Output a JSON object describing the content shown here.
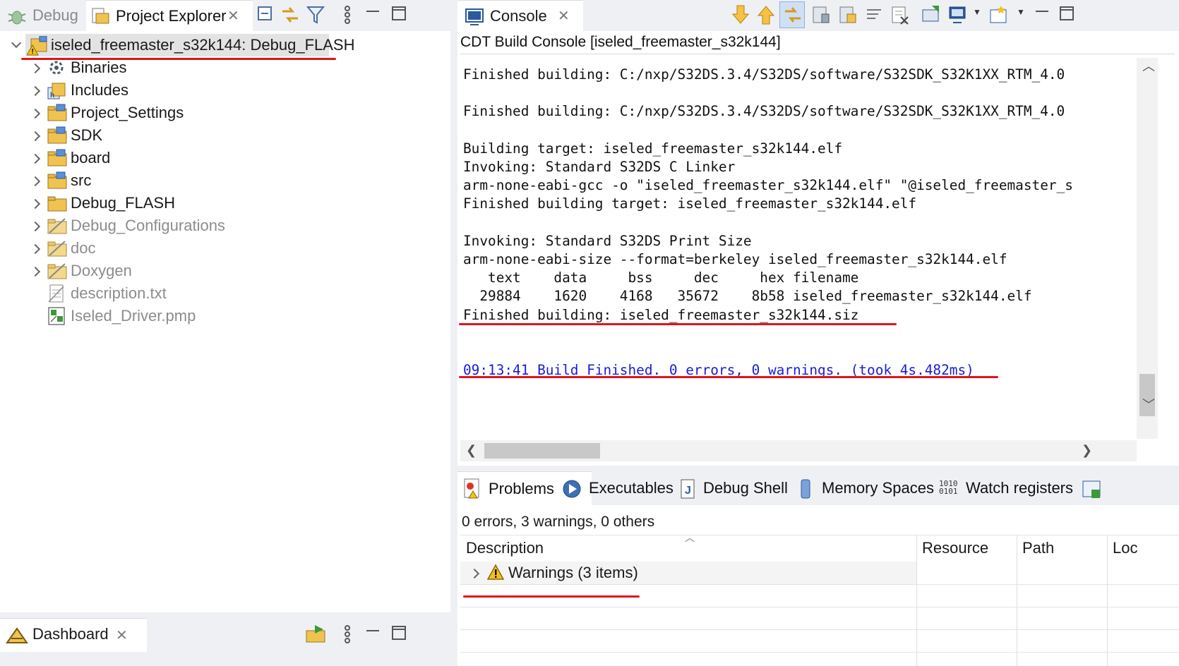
{
  "left_panel": {
    "tabs": [
      {
        "label": "Debug",
        "icon": "bug-icon",
        "active": false
      },
      {
        "label": "Project Explorer",
        "icon": "project-explorer-icon",
        "active": true
      }
    ],
    "toolbar": [
      "collapse-all-icon",
      "link-with-editor-icon",
      "filter-icon",
      "view-menu-icon",
      "minimize-icon",
      "maximize-icon"
    ],
    "tree": {
      "root": {
        "label": "iseled_freemaster_s32k144: Debug_FLASH",
        "expanded": true
      },
      "items": [
        {
          "label": "Binaries",
          "icon": "binaries-icon",
          "gray": false,
          "has_twisty": true
        },
        {
          "label": "Includes",
          "icon": "includes-icon",
          "gray": false,
          "has_twisty": true
        },
        {
          "label": "Project_Settings",
          "icon": "source-folder-icon",
          "gray": false,
          "has_twisty": true
        },
        {
          "label": "SDK",
          "icon": "source-folder-icon",
          "gray": false,
          "has_twisty": true
        },
        {
          "label": "board",
          "icon": "source-folder-icon",
          "gray": false,
          "has_twisty": true
        },
        {
          "label": "src",
          "icon": "source-folder-icon",
          "gray": false,
          "has_twisty": true
        },
        {
          "label": "Debug_FLASH",
          "icon": "folder-icon",
          "gray": false,
          "has_twisty": true
        },
        {
          "label": "Debug_Configurations",
          "icon": "excluded-folder-icon",
          "gray": true,
          "has_twisty": true
        },
        {
          "label": "doc",
          "icon": "excluded-folder-icon",
          "gray": true,
          "has_twisty": true
        },
        {
          "label": "Doxygen",
          "icon": "excluded-folder-icon",
          "gray": true,
          "has_twisty": true
        },
        {
          "label": "description.txt",
          "icon": "text-file-icon",
          "gray": true,
          "has_twisty": false
        },
        {
          "label": "Iseled_Driver.pmp",
          "icon": "pmp-file-icon",
          "gray": true,
          "has_twisty": false
        }
      ]
    }
  },
  "dashboard": {
    "tab_label": "Dashboard"
  },
  "console": {
    "tab_label": "Console",
    "title": "CDT Build Console [iseled_freemaster_s32k144]",
    "lines": [
      "Finished building: C:/nxp/S32DS.3.4/S32DS/software/S32SDK_S32K1XX_RTM_4.0",
      "",
      "Finished building: C:/nxp/S32DS.3.4/S32DS/software/S32SDK_S32K1XX_RTM_4.0",
      "",
      "Building target: iseled_freemaster_s32k144.elf",
      "Invoking: Standard S32DS C Linker",
      "arm-none-eabi-gcc -o \"iseled_freemaster_s32k144.elf\" \"@iseled_freemaster_s",
      "Finished building target: iseled_freemaster_s32k144.elf",
      "",
      "Invoking: Standard S32DS Print Size",
      "arm-none-eabi-size --format=berkeley iseled_freemaster_s32k144.elf",
      "   text    data     bss     dec     hex filename",
      "  29884    1620    4168   35672    8b58 iseled_freemaster_s32k144.elf",
      "Finished building: iseled_freemaster_s32k144.siz",
      "",
      "",
      "09:13:41 Build Finished. 0 errors, 0 warnings. (took 4s.482ms)"
    ],
    "status_color": "#1b1bd6"
  },
  "problems": {
    "tabs": [
      {
        "label": "Problems",
        "icon": "problems-icon"
      },
      {
        "label": "Executables",
        "icon": "executables-icon"
      },
      {
        "label": "Debug Shell",
        "icon": "debug-shell-icon"
      },
      {
        "label": "Memory Spaces",
        "icon": "memory-spaces-icon"
      },
      {
        "label": "Watch registers",
        "icon": "watch-registers-icon"
      }
    ],
    "summary": "0 errors, 3 warnings, 0 others",
    "columns": [
      "Description",
      "Resource",
      "Path",
      "Loc"
    ],
    "rows": [
      {
        "label": "Warnings (3 items)",
        "icon": "warning-icon"
      }
    ]
  },
  "colors": {
    "highlight_red": "#e0141d",
    "warning_yellow": "#f3c21b"
  }
}
